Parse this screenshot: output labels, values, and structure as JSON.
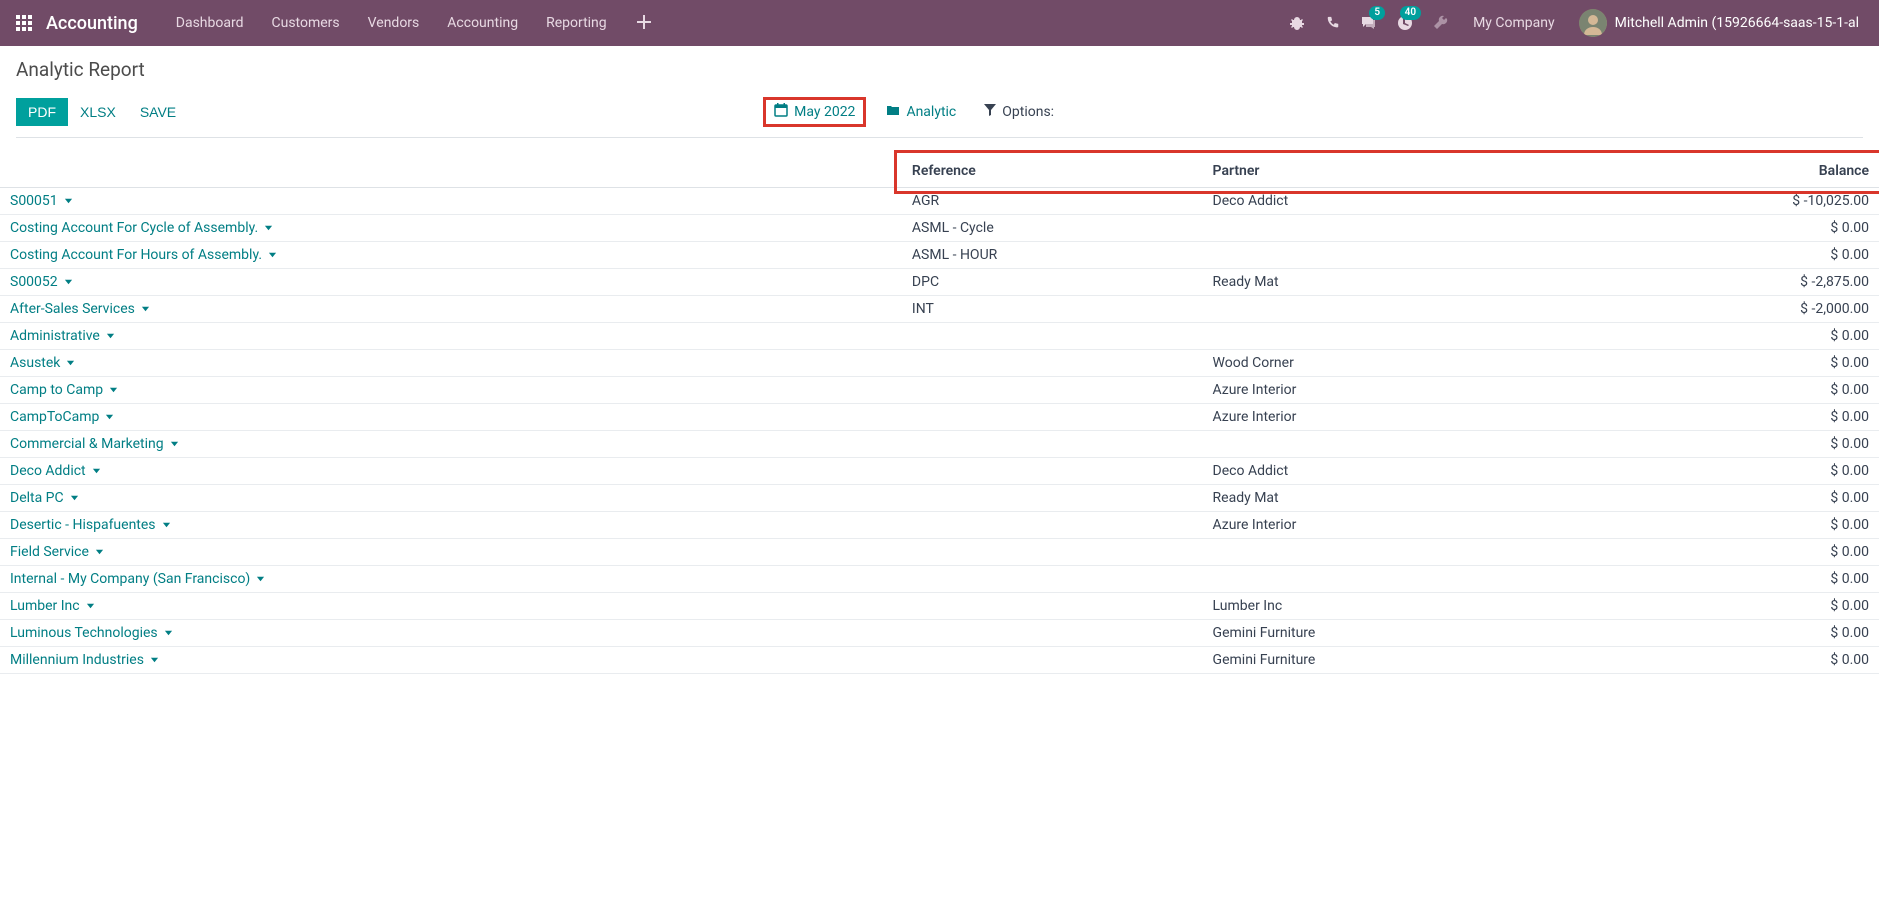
{
  "topbar": {
    "brand": "Accounting",
    "nav": [
      "Dashboard",
      "Customers",
      "Vendors",
      "Accounting",
      "Reporting"
    ],
    "messages_badge": "5",
    "activities_badge": "40",
    "company": "My Company",
    "user": "Mitchell Admin (15926664-saas-15-1-al"
  },
  "header": {
    "title": "Analytic Report",
    "buttons": {
      "pdf": "PDF",
      "xlsx": "XLSX",
      "save": "SAVE"
    },
    "date": "May 2022",
    "analytic": "Analytic",
    "options": "Options:"
  },
  "columns": {
    "reference": "Reference",
    "partner": "Partner",
    "balance": "Balance"
  },
  "rows": [
    {
      "name": "S00051",
      "reference": "AGR",
      "partner": "Deco Addict",
      "balance": "$ -10,025.00"
    },
    {
      "name": "Costing Account For Cycle of Assembly.",
      "reference": "ASML - Cycle",
      "partner": "",
      "balance": "$ 0.00"
    },
    {
      "name": "Costing Account For Hours of Assembly.",
      "reference": "ASML - HOUR",
      "partner": "",
      "balance": "$ 0.00"
    },
    {
      "name": "S00052",
      "reference": "DPC",
      "partner": "Ready Mat",
      "balance": "$ -2,875.00"
    },
    {
      "name": "After-Sales Services",
      "reference": "INT",
      "partner": "",
      "balance": "$ -2,000.00"
    },
    {
      "name": "Administrative",
      "reference": "",
      "partner": "",
      "balance": "$ 0.00"
    },
    {
      "name": "Asustek",
      "reference": "",
      "partner": "Wood Corner",
      "balance": "$ 0.00"
    },
    {
      "name": "Camp to Camp",
      "reference": "",
      "partner": "Azure Interior",
      "balance": "$ 0.00"
    },
    {
      "name": "CampToCamp",
      "reference": "",
      "partner": "Azure Interior",
      "balance": "$ 0.00"
    },
    {
      "name": "Commercial & Marketing",
      "reference": "",
      "partner": "",
      "balance": "$ 0.00"
    },
    {
      "name": "Deco Addict",
      "reference": "",
      "partner": "Deco Addict",
      "balance": "$ 0.00"
    },
    {
      "name": "Delta PC",
      "reference": "",
      "partner": "Ready Mat",
      "balance": "$ 0.00"
    },
    {
      "name": "Desertic - Hispafuentes",
      "reference": "",
      "partner": "Azure Interior",
      "balance": "$ 0.00"
    },
    {
      "name": "Field Service",
      "reference": "",
      "partner": "",
      "balance": "$ 0.00"
    },
    {
      "name": "Internal - My Company (San Francisco)",
      "reference": "",
      "partner": "",
      "balance": "$ 0.00"
    },
    {
      "name": "Lumber Inc",
      "reference": "",
      "partner": "Lumber Inc",
      "balance": "$ 0.00"
    },
    {
      "name": "Luminous Technologies",
      "reference": "",
      "partner": "Gemini Furniture",
      "balance": "$ 0.00"
    },
    {
      "name": "Millennium Industries",
      "reference": "",
      "partner": "Gemini Furniture",
      "balance": "$ 0.00"
    }
  ]
}
